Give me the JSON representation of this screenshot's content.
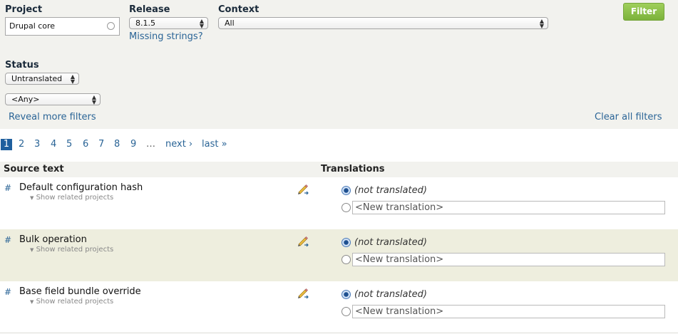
{
  "filters": {
    "project_label": "Project",
    "project_value": "Drupal core",
    "release_label": "Release",
    "release_value": "8.1.5",
    "missing_strings": "Missing strings?",
    "context_label": "Context",
    "context_value": "All",
    "filter_button": "Filter",
    "status_label": "Status",
    "status_value": "Untranslated",
    "any_value": "<Any>",
    "reveal_more": "Reveal more filters",
    "clear_all": "Clear all filters"
  },
  "pager": {
    "current": "1",
    "pages": [
      "2",
      "3",
      "4",
      "5",
      "6",
      "7",
      "8",
      "9"
    ],
    "ellipsis": "…",
    "next": "next ›",
    "last": "last »"
  },
  "table": {
    "source_header": "Source text",
    "translations_header": "Translations",
    "rows": [
      {
        "hash": "#",
        "source": "Default configuration hash",
        "related": "Show related projects",
        "not_translated": "(not translated)",
        "new_translation": "<New translation>"
      },
      {
        "hash": "#",
        "source": "Bulk operation",
        "related": "Show related projects",
        "not_translated": "(not translated)",
        "new_translation": "<New translation>"
      },
      {
        "hash": "#",
        "source": "Base field bundle override",
        "related": "Show related projects",
        "not_translated": "(not translated)",
        "new_translation": "<New translation>"
      }
    ]
  },
  "icons": {
    "edit": "pencil-edit-icon",
    "select_arrows": "select-arrows-icon",
    "related_toggle": "triangle-down-icon"
  },
  "colors": {
    "filter_button": "#7cb23b",
    "link": "#2a6496",
    "current_page": "#1f5f9e",
    "filter_bg": "#f2f2ee",
    "alt_row_bg": "#eeeede"
  }
}
